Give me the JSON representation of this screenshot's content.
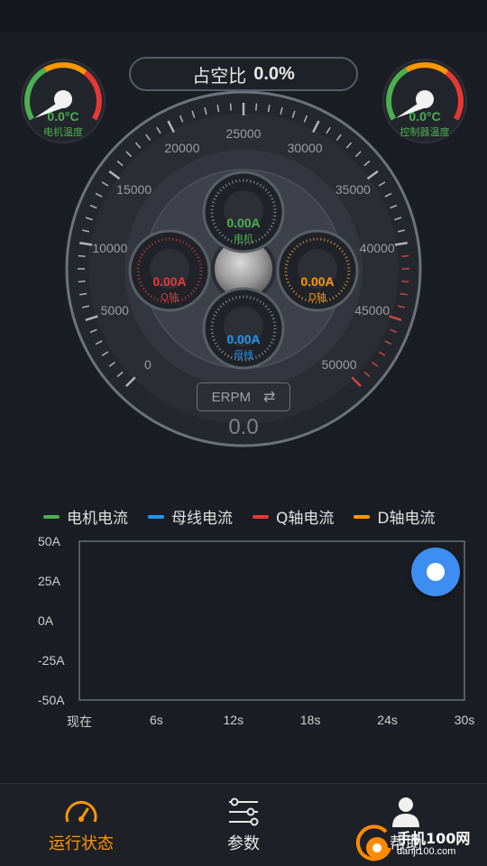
{
  "duty": {
    "label": "占空比",
    "value": "0.0%"
  },
  "motor_temp": {
    "value": "0.0°C",
    "label": "电机温度"
  },
  "controller_temp": {
    "value": "0.0°C",
    "label": "控制器温度"
  },
  "dial": {
    "tick_labels": [
      "0",
      "5000",
      "10000",
      "15000",
      "20000",
      "25000",
      "30000",
      "35000",
      "40000",
      "45000",
      "50000"
    ],
    "rpm_value": "0.0",
    "mode_label": "ERPM"
  },
  "sub_gauges": {
    "motor": {
      "value": "0.00A",
      "label": "电机",
      "color": "#4caf50"
    },
    "q_axis": {
      "value": "0.00A",
      "label": "Q轴",
      "color": "#e53935"
    },
    "d_axis": {
      "value": "0.00A",
      "label": "D轴",
      "color": "#ff9800"
    },
    "bus": {
      "value": "0.00A",
      "label": "母线",
      "color": "#2196f3"
    }
  },
  "legend": [
    {
      "label": "电机电流",
      "color": "#4caf50"
    },
    {
      "label": "母线电流",
      "color": "#2196f3"
    },
    {
      "label": "Q轴电流",
      "color": "#e53935"
    },
    {
      "label": "D轴电流",
      "color": "#ff9800"
    }
  ],
  "chart_data": {
    "type": "line",
    "x_tick_labels": [
      "现在",
      "6s",
      "12s",
      "18s",
      "24s",
      "30s"
    ],
    "y_tick_labels": [
      "50A",
      "25A",
      "0A",
      "-25A",
      "-50A"
    ],
    "ylim": [
      -50,
      50
    ],
    "series": [
      {
        "name": "电机电流",
        "color": "#4caf50",
        "values": []
      },
      {
        "name": "母线电流",
        "color": "#2196f3",
        "values": []
      },
      {
        "name": "Q轴电流",
        "color": "#e53935",
        "values": []
      },
      {
        "name": "D轴电流",
        "color": "#ff9800",
        "values": []
      }
    ]
  },
  "nav": {
    "status": {
      "label": "运行状态",
      "icon": "speedometer-icon",
      "color": "#ff9800"
    },
    "params": {
      "label": "参数",
      "icon": "sliders-icon"
    },
    "help": {
      "label": "帮助",
      "icon": "user-icon"
    }
  },
  "watermark": {
    "title": "手机100网",
    "url": "danji100.com"
  }
}
